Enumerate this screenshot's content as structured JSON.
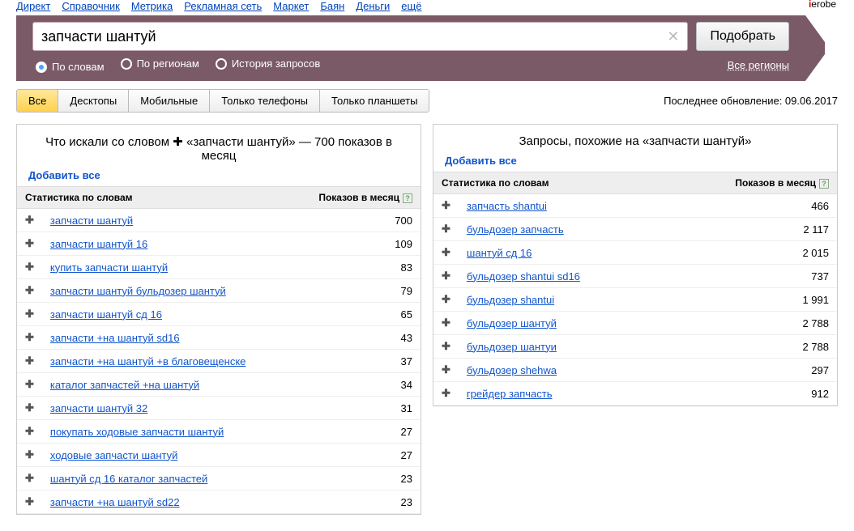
{
  "brand": "ierobe",
  "topNav": [
    "Директ",
    "Справочник",
    "Метрика",
    "Рекламная сеть",
    "Маркет",
    "Баян",
    "Деньги",
    "ещё"
  ],
  "search": {
    "value": "запчасти шантуй",
    "submit": "Подобрать"
  },
  "filters": {
    "options": [
      {
        "label": "По словам",
        "checked": true
      },
      {
        "label": "По регионам",
        "checked": false
      },
      {
        "label": "История запросов",
        "checked": false
      }
    ],
    "allRegions": "Все регионы"
  },
  "deviceTabs": [
    "Все",
    "Десктопы",
    "Мобильные",
    "Только телефоны",
    "Только планшеты"
  ],
  "activeDeviceTab": 0,
  "lastUpdate": "Последнее обновление: 09.06.2017",
  "columns": {
    "statLabel": "Статистика по словам",
    "countLabel": "Показов в месяц",
    "addAll": "Добавить все"
  },
  "leftPanel": {
    "titlePrefix": "Что искали со словом",
    "queryQuoted": "«запчасти шантуй»",
    "totalSuffix": "— 700 показов в месяц",
    "rows": [
      {
        "kw": "запчасти шантуй",
        "n": "700"
      },
      {
        "kw": "запчасти шантуй 16",
        "n": "109"
      },
      {
        "kw": "купить запчасти шантуй",
        "n": "83"
      },
      {
        "kw": "запчасти шантуй бульдозер шантуй",
        "n": "79"
      },
      {
        "kw": "запчасти шантуй сд 16",
        "n": "65"
      },
      {
        "kw": "запчасти +на шантуй sd16",
        "n": "43"
      },
      {
        "kw": "запчасти +на шантуй +в благовещенске",
        "n": "37"
      },
      {
        "kw": "каталог запчастей +на шантуй",
        "n": "34"
      },
      {
        "kw": "запчасти шантуй 32",
        "n": "31"
      },
      {
        "kw": "покупать ходовые запчасти шантуй",
        "n": "27"
      },
      {
        "kw": "ходовые запчасти шантуй",
        "n": "27"
      },
      {
        "kw": "шантуй сд 16 каталог запчастей",
        "n": "23"
      },
      {
        "kw": "запчасти +на шантуй sd22",
        "n": "23"
      }
    ]
  },
  "rightPanel": {
    "title": "Запросы, похожие на «запчасти шантуй»",
    "rows": [
      {
        "kw": "запчасть shantui",
        "n": "466"
      },
      {
        "kw": "бульдозер запчасть",
        "n": "2 117"
      },
      {
        "kw": "шантуй сд 16",
        "n": "2 015"
      },
      {
        "kw": "бульдозер shantui sd16",
        "n": "737"
      },
      {
        "kw": "бульдозер shantui",
        "n": "1 991"
      },
      {
        "kw": "бульдозер шантуй",
        "n": "2 788"
      },
      {
        "kw": "бульдозер шантуи",
        "n": "2 788"
      },
      {
        "kw": "бульдозер shehwa",
        "n": "297"
      },
      {
        "kw": "грейдер запчасть",
        "n": "912"
      }
    ]
  }
}
